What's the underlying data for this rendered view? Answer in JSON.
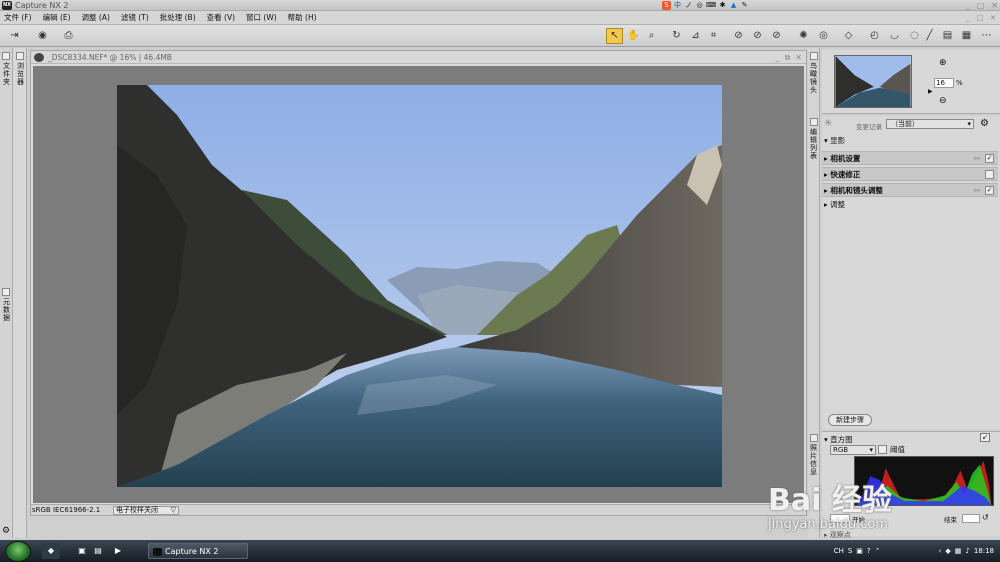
{
  "window": {
    "title": "Capture NX 2",
    "logo": "NX"
  },
  "ime_bar": [
    "S",
    "中",
    "ノ",
    "◎",
    "⌨",
    "✱",
    "▲",
    "✎"
  ],
  "menu": [
    "文件 (F)",
    "编辑 (E)",
    "调整 (A)",
    "滤镜 (T)",
    "批处理 (B)",
    "查看 (V)",
    "窗口 (W)",
    "帮助 (H)"
  ],
  "left_panels": {
    "folder": "文件夹",
    "browser": "浏览器",
    "metadata": "元数据"
  },
  "document": {
    "tab_title": "_DSC8334.NEF* @ 16% | 46.4MB",
    "color_profile": "sRGB IEC61966-2.1",
    "soft_proof": "电子校样关闭"
  },
  "right_panels": {
    "navigator_label": "鸟瞰镜头",
    "zoom_value": "16",
    "zoom_unit": "%",
    "edit_list_label": "编辑列表",
    "version_label": "变更记录",
    "version_value": "（当前）",
    "section_develop": "显影",
    "steps": [
      {
        "label": "相机设置",
        "checked": true
      },
      {
        "label": "快速修正",
        "checked": false
      },
      {
        "label": "相机和镜头调整",
        "checked": true
      }
    ],
    "section_adjust": "调整",
    "new_step": "新建步骤",
    "photo_info_label": "照片信息",
    "histogram_title": "直方图",
    "histogram_channel": "RGB",
    "threshold_label": "阈值",
    "hist_start_label": "开始",
    "hist_end_label": "结束",
    "watch_point": "观察点"
  },
  "taskbar": {
    "app": "Capture NX 2",
    "lang": "CH",
    "time": "18:18"
  },
  "watermark": {
    "text": "Bai 经验",
    "url": "jingyan.baidu.com"
  },
  "colors": {
    "active_tool": "#f2c94c",
    "sky": "#9fbcea",
    "water": "#2c4a5c"
  }
}
